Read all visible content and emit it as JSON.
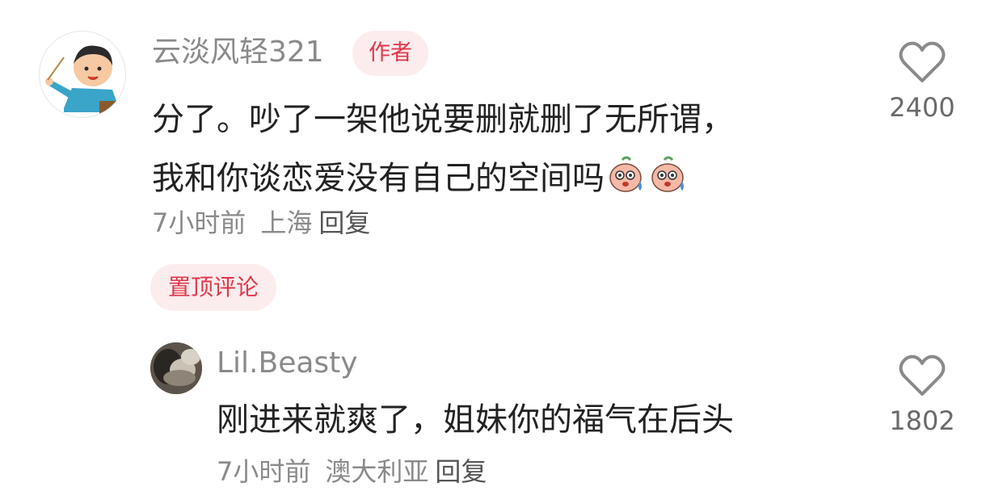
{
  "comments": [
    {
      "username": "云淡风轻321",
      "badge": "作者",
      "text_line1": "分了。吵了一架他说要删就删了无所谓，",
      "text_line2": "我和你谈恋爱没有自己的空间吗",
      "emojis": [
        "sweat-face-icon",
        "sweat-face-icon"
      ],
      "time": "7小时前",
      "location": "上海",
      "reply_label": "回复",
      "likes": "2400",
      "pinned_label": "置顶评论"
    },
    {
      "username": "Lil.Beasty",
      "text": "刚进来就爽了，姐妹你的福气在后头",
      "time": "7小时前",
      "location": "澳大利亚",
      "reply_label": "回复",
      "likes": "1802"
    }
  ],
  "colors": {
    "badge_bg": "#fdecee",
    "badge_text": "#e0374a",
    "meta": "#8a8a8a",
    "text": "#222222"
  }
}
